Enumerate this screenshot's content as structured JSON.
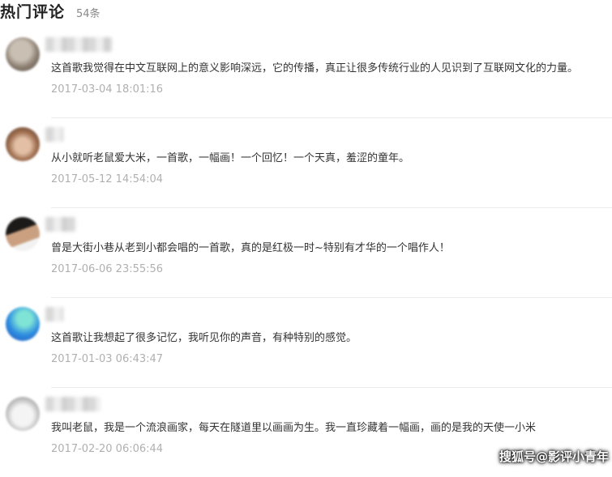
{
  "header": {
    "title": "热门评论",
    "count": "54条"
  },
  "comments": [
    {
      "text": "这首歌我觉得在中文互联网上的意义影响深远，它的传播，真正让很多传统行业的人见识到了互联网文化的力量。",
      "time": "2017-03-04 18:01:16",
      "avatar_icon": "user-avatar-blurred-icon",
      "avatar_colors": [
        "#8a7d70",
        "#c9bfb3"
      ]
    },
    {
      "text": "从小就听老鼠爱大米，一首歌，一幅画！一个回忆！一个天真，羞涩的童年。",
      "time": "2017-05-12 14:54:04",
      "avatar_icon": "user-avatar-blurred-icon",
      "avatar_colors": [
        "#6b4a36",
        "#d9b49a"
      ]
    },
    {
      "text": "曾是大街小巷从老到小都会唱的一首歌，真的是红极一时~特别有才华的一个唱作人！",
      "time": "2017-06-06 23:55:56",
      "avatar_icon": "user-avatar-blurred-icon",
      "avatar_colors": [
        "#2a2420",
        "#d6a88a"
      ]
    },
    {
      "text": "这首歌让我想起了很多记忆，我听见你的声音，有种特别的感觉。",
      "time": "2017-01-03 06:43:47",
      "avatar_icon": "user-avatar-blurred-icon",
      "avatar_colors": [
        "#2a6fd6",
        "#5fd0c8"
      ]
    },
    {
      "text": "我叫老鼠，我是一个流浪画家，每天在隧道里以画画为生。我一直珍藏着一幅画，画的是我的天使一小米",
      "time": "2017-02-20 06:06:44",
      "avatar_icon": "user-avatar-blurred-icon",
      "avatar_colors": [
        "#e6e6e6",
        "#9a9a9a"
      ]
    }
  ],
  "watermark": "搜狐号@影评小青年"
}
